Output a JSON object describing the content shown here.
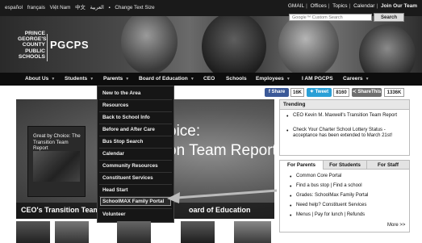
{
  "top": {
    "languages": [
      "español",
      "français",
      "Việt Nam",
      "中文",
      "العربية"
    ],
    "change_text_size": "Change Text Size",
    "utility": [
      "GMAIL",
      "Offices",
      "Topics",
      "Calendar",
      "Join Our Team"
    ],
    "search_placeholder": "Google™ Custom Search",
    "search_label": "Search"
  },
  "logo": {
    "lines": [
      "PRINCE",
      "GEORGE'S",
      "COUNTY",
      "PUBLIC",
      "SCHOOLS"
    ],
    "abbr": "PGCPS"
  },
  "nav": [
    "About Us",
    "Students",
    "Parents",
    "Board of Education",
    "CEO",
    "Schools",
    "Employees",
    "I AM PGCPS",
    "Careers"
  ],
  "dropdown": [
    "New to the Area",
    "Resources",
    "Back to School Info",
    "Before and After Care",
    "Bus Stop Search",
    "Calendar",
    "Community Resources",
    "Constituent Services",
    "Head Start",
    "SchoolMAX Family Portal",
    "Volunteer"
  ],
  "share": {
    "facebook": "Share",
    "facebook_count": "16K",
    "twitter": "Tweet",
    "twitter_count": "8160",
    "sharethis": "ShareThis",
    "sharethis_count": "1336K"
  },
  "hero": {
    "book_title": "Great by Choice: The Transition Team Report",
    "title_line1": "oice:",
    "title_line2": "on Team Report",
    "caption": "CEO's Transition Team",
    "caption2": "oard of Education"
  },
  "trending": {
    "title": "Trending",
    "items": [
      "CEO Kevin M. Maxwell's Transition Team Report",
      "Check Your Charter School Lottery Status - acceptance has been extended to March 21st!"
    ]
  },
  "tabs": {
    "labels": [
      "For Parents",
      "For Students",
      "For Staff"
    ],
    "items": [
      "Common Core Portal",
      "Find a bus stop | Find a school",
      "Grades: SchoolMax Family Portal",
      "Need help? Constituent Services",
      "Menus | Pay for lunch | Refunds"
    ],
    "more": "More >>"
  }
}
